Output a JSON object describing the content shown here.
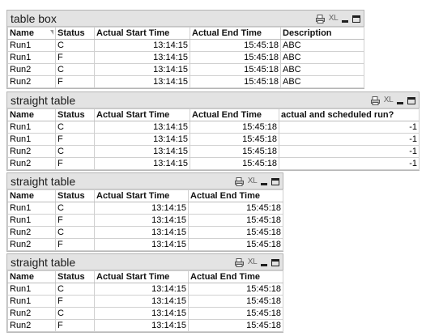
{
  "icons": {
    "print": "printer-icon",
    "excel": "XL",
    "minimize": "minimize-icon",
    "maximize": "maximize-icon"
  },
  "box1": {
    "title": "table box",
    "headers": [
      "Name",
      "Status",
      "Actual Start Time",
      "Actual End Time",
      "Description"
    ],
    "rows": [
      [
        "Run1",
        "C",
        "13:14:15",
        "15:45:18",
        "ABC"
      ],
      [
        "Run1",
        "F",
        "13:14:15",
        "15:45:18",
        "ABC"
      ],
      [
        "Run2",
        "C",
        "13:14:15",
        "15:45:18",
        "ABC"
      ],
      [
        "Run2",
        "F",
        "13:14:15",
        "15:45:18",
        "ABC"
      ]
    ]
  },
  "box2": {
    "title": "straight table",
    "headers": [
      "Name",
      "Status",
      "Actual Start Time",
      "Actual End Time",
      "actual and scheduled run?"
    ],
    "rows": [
      [
        "Run1",
        "C",
        "13:14:15",
        "15:45:18",
        "-1"
      ],
      [
        "Run1",
        "F",
        "13:14:15",
        "15:45:18",
        "-1"
      ],
      [
        "Run2",
        "C",
        "13:14:15",
        "15:45:18",
        "-1"
      ],
      [
        "Run2",
        "F",
        "13:14:15",
        "15:45:18",
        "-1"
      ]
    ]
  },
  "box3": {
    "title": "straight table",
    "headers": [
      "Name",
      "Status",
      "Actual Start Time",
      "Actual End Time"
    ],
    "rows": [
      [
        "Run1",
        "C",
        "13:14:15",
        "15:45:18"
      ],
      [
        "Run1",
        "F",
        "13:14:15",
        "15:45:18"
      ],
      [
        "Run2",
        "C",
        "13:14:15",
        "15:45:18"
      ],
      [
        "Run2",
        "F",
        "13:14:15",
        "15:45:18"
      ]
    ]
  },
  "box4": {
    "title": "straight table",
    "headers": [
      "Name",
      "Status",
      "Actual Start Time",
      "Actual End Time"
    ],
    "rows": [
      [
        "Run1",
        "C",
        "13:14:15",
        "15:45:18"
      ],
      [
        "Run1",
        "F",
        "13:14:15",
        "15:45:18"
      ],
      [
        "Run2",
        "C",
        "13:14:15",
        "15:45:18"
      ],
      [
        "Run2",
        "F",
        "13:14:15",
        "15:45:18"
      ]
    ]
  }
}
